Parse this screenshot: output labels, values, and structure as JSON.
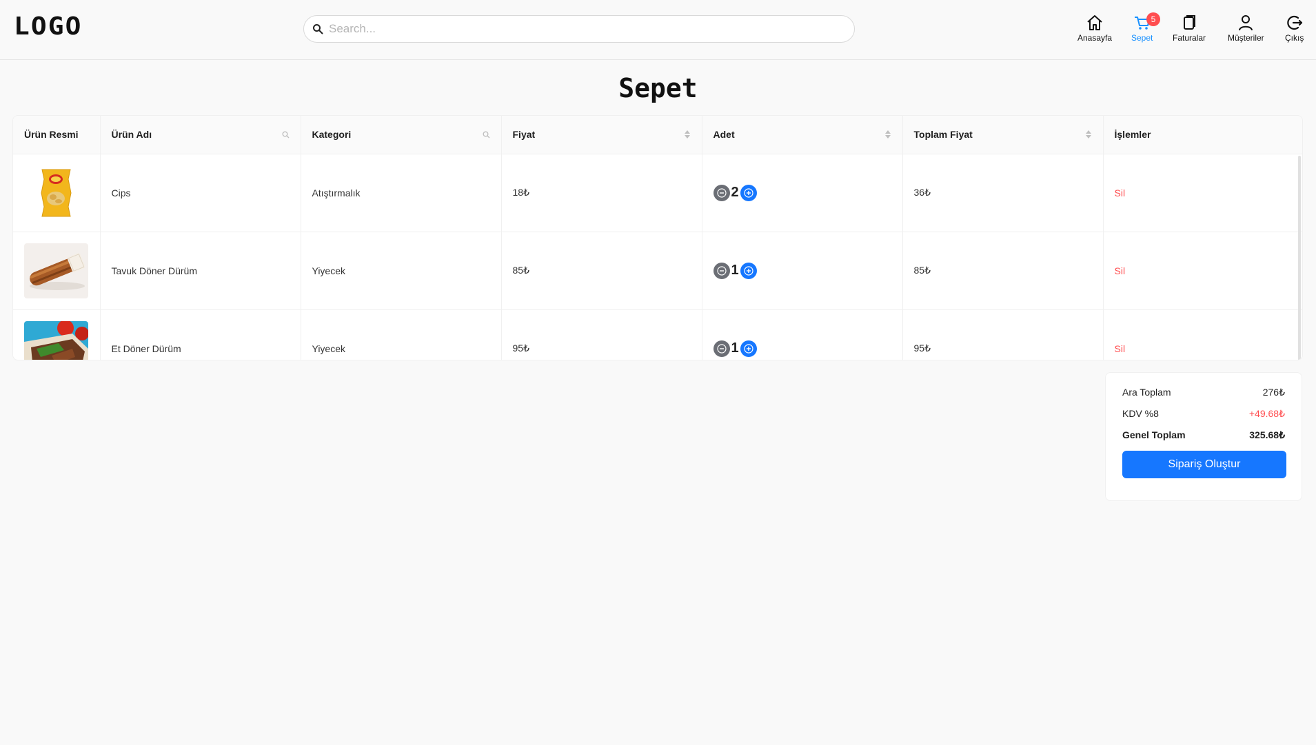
{
  "header": {
    "logo": "LOGO",
    "search_placeholder": "Search...",
    "nav": [
      {
        "label": "Anasayfa",
        "icon": "home-icon"
      },
      {
        "label": "Sepet",
        "icon": "cart-icon",
        "badge": "5",
        "active": true
      },
      {
        "label": "Faturalar",
        "icon": "invoice-icon"
      },
      {
        "label": "Müşteriler",
        "icon": "user-icon"
      },
      {
        "label": "Çıkış",
        "icon": "logout-icon"
      }
    ]
  },
  "page_title": "Sepet",
  "table": {
    "columns": [
      "Ürün Resmi",
      "Ürün Adı",
      "Kategori",
      "Fiyat",
      "Adet",
      "Toplam Fiyat",
      "İşlemler"
    ],
    "rows": [
      {
        "name": "Cips",
        "category": "Atıştırmalık",
        "price": "18₺",
        "qty": "2",
        "total": "36₺",
        "action": "Sil",
        "image": "chips-bag"
      },
      {
        "name": "Tavuk Döner Dürüm",
        "category": "Yiyecek",
        "price": "85₺",
        "qty": "1",
        "total": "85₺",
        "action": "Sil",
        "image": "chicken-wrap"
      },
      {
        "name": "Et Döner Dürüm",
        "category": "Yiyecek",
        "price": "95₺",
        "qty": "1",
        "total": "95₺",
        "action": "Sil",
        "image": "meat-wrap"
      }
    ]
  },
  "summary": {
    "subtotal_label": "Ara Toplam",
    "subtotal_value": "276₺",
    "tax_label": "KDV %8",
    "tax_value": "+49.68₺",
    "grand_label": "Genel Toplam",
    "grand_value": "325.68₺",
    "order_button": "Sipariş Oluştur"
  },
  "colors": {
    "accent": "#1677ff",
    "danger": "#ff4d4f",
    "active_nav": "#1890ff"
  }
}
